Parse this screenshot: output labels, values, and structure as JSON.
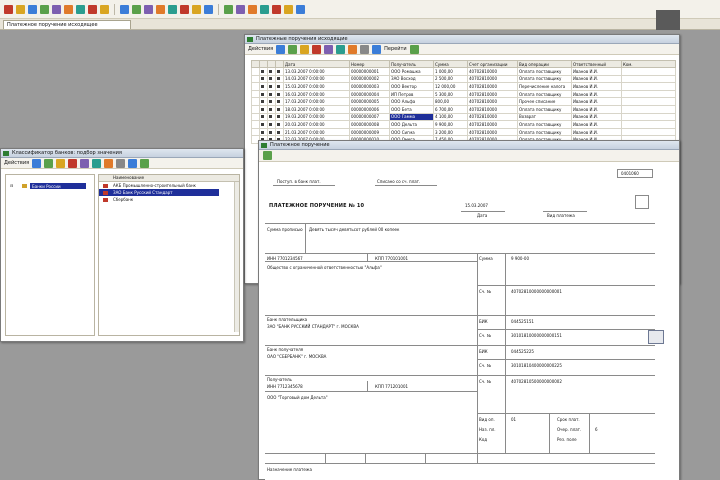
{
  "window_tab": {
    "label": "Платежное поручение исходящее"
  },
  "list_window": {
    "title": "Платежные поручения исходящие",
    "toolbar_action": "Действия",
    "toolbar_extra": "Перейти",
    "columns": [
      "",
      "",
      "",
      "Дата",
      "Номер",
      "Получатель",
      "Сумма",
      "Счет организации",
      "Вид операции",
      "Ответственный",
      "Ком."
    ],
    "rows": [
      [
        "",
        "",
        "",
        "13.03.2007 0:00:00",
        "00000000001",
        "ООО Ромашка",
        "1 000,00",
        "40702810000",
        "Оплата поставщику",
        "Иванов И.И.",
        ""
      ],
      [
        "",
        "",
        "",
        "14.03.2007 0:00:00",
        "00000000002",
        "ЗАО Восход",
        "2 500,00",
        "40702810000",
        "Оплата поставщику",
        "Иванов И.И.",
        ""
      ],
      [
        "",
        "",
        "",
        "15.03.2007 0:00:00",
        "00000000003",
        "ООО Вектор",
        "12 000,00",
        "40702810000",
        "Перечисление налога",
        "Иванов И.И.",
        ""
      ],
      [
        "",
        "",
        "",
        "16.03.2007 0:00:00",
        "00000000004",
        "ИП Петров",
        "5 300,00",
        "40702810000",
        "Оплата поставщику",
        "Иванов И.И.",
        ""
      ],
      [
        "",
        "",
        "",
        "17.03.2007 0:00:00",
        "00000000005",
        "ООО Альфа",
        "800,00",
        "40702810000",
        "Прочее списание",
        "Иванов И.И.",
        ""
      ],
      [
        "",
        "",
        "",
        "18.03.2007 0:00:00",
        "00000000006",
        "ООО Бета",
        "6 700,00",
        "40702810000",
        "Оплата поставщику",
        "Иванов И.И.",
        ""
      ],
      [
        "",
        "",
        "",
        "19.03.2007 0:00:00",
        "00000000007",
        "ООО Гамма",
        "4 100,00",
        "40702810000",
        "Возврат",
        "Иванов И.И.",
        ""
      ],
      [
        "",
        "",
        "",
        "20.03.2007 0:00:00",
        "00000000008",
        "ООО Дельта",
        "9 900,00",
        "40702810000",
        "Оплата поставщику",
        "Иванов И.И.",
        ""
      ],
      [
        "",
        "",
        "",
        "21.03.2007 0:00:00",
        "00000000009",
        "ООО Сигма",
        "3 200,00",
        "40702810000",
        "Оплата поставщику",
        "Иванов И.И.",
        ""
      ],
      [
        "",
        "",
        "",
        "22.03.2007 0:00:00",
        "00000000010",
        "ООО Омега",
        "7 450,00",
        "40702810000",
        "Оплата поставщику",
        "Иванов И.И.",
        ""
      ]
    ],
    "selected_row": 6
  },
  "tree_window": {
    "title": "Классификатор банков: подбор значения",
    "toolbar_action": "Действия",
    "tree_root": "Банки России",
    "list_header": "Наименование",
    "list_rows": [
      {
        "label": "АКБ Промышленно-строительный банк"
      },
      {
        "label": "ЗАО Банк Русский Стандарт",
        "selected": true
      },
      {
        "label": "Сбербанк"
      }
    ]
  },
  "doc_window": {
    "title": "Платежное поручение",
    "received_label": "Поступ. в банк плат.",
    "debited_label": "Списано со сч. плат.",
    "form_code": "0401060",
    "doc_title": "ПЛАТЕЖНОЕ ПОРУЧЕНИЕ № 10",
    "doc_date": "15.03.2007",
    "date_caption": "Дата",
    "payment_type_caption": "Вид платежа",
    "amount_words_label": "Сумма прописью",
    "amount_words": "Девять тысяч девятьсот рублей 00 копеек",
    "inn_label": "ИНН 7701234567",
    "kpp_label": "КПП 770101001",
    "amount_label": "Сумма",
    "amount_value": "9 900-00",
    "payer_name": "Общество с ограниченной ответственностью \"Альфа\"",
    "account_label": "Сч. №",
    "payer_account": "40702810000000000001",
    "payer_bank_label": "Банк плательщика",
    "payer_bank": "ЗАО \"БАНК РУССКИЙ СТАНДАРТ\" г. МОСКВА",
    "bik_label": "БИК",
    "bik_value": "044525151",
    "corr_account": "30101810000000000151",
    "receiver_bank_label": "Банк получателя",
    "receiver_bank": "ОАО \"СБЕРБАНК\" г. МОСКВА",
    "receiver_bik": "044525225",
    "receiver_corr": "30101810400000000225",
    "receiver_label": "Получатель",
    "receiver_inn": "ИНН 7712345678",
    "receiver_kpp": "КПП 771201001",
    "receiver_name": "ООО \"Торговый дом Дельта\"",
    "receiver_account": "40702810500000000002",
    "op_type_label": "Вид оп.",
    "op_type_value": "01",
    "deadline_label": "Срок плат.",
    "purpose_label": "Наз. пл.",
    "order_label": "Очер. плат.",
    "order_value": "6",
    "code_label": "Код",
    "reserve_label": "Рез. поле",
    "purpose_caption": "Назначение платежа"
  }
}
